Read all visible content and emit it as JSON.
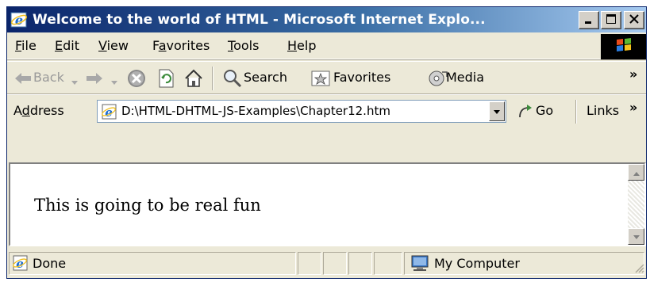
{
  "window": {
    "title": "Welcome to the world of HTML - Microsoft Internet Explo..."
  },
  "menu": {
    "items": [
      {
        "label": "File",
        "u": "F",
        "rest": "ile"
      },
      {
        "label": "Edit",
        "u": "E",
        "rest": "dit"
      },
      {
        "label": "View",
        "u": "V",
        "rest": "iew"
      },
      {
        "label": "Favorites",
        "pre": "F",
        "u": "a",
        "rest": "vorites"
      },
      {
        "label": "Tools",
        "u": "T",
        "rest": "ools"
      },
      {
        "label": "Help",
        "u": "H",
        "rest": "elp"
      }
    ]
  },
  "toolbar": {
    "back_label": "Back",
    "search_label": "Search",
    "favorites_label": "Favorites",
    "media_label": "Media",
    "chevron": "»"
  },
  "address": {
    "label_pre": "A",
    "label_u": "d",
    "label_rest": "dress",
    "value": "D:\\HTML-DHTML-JS-Examples\\Chapter12.htm",
    "go_label": "Go",
    "links_label": "Links",
    "chevron": "»"
  },
  "content": {
    "text": "This is going to be real fun"
  },
  "status": {
    "left_text": "Done",
    "zone_text": "My Computer"
  },
  "colors": {
    "title_gradient_start": "#0a246a",
    "title_gradient_end": "#a6caf0",
    "chrome": "#ece9d8"
  }
}
